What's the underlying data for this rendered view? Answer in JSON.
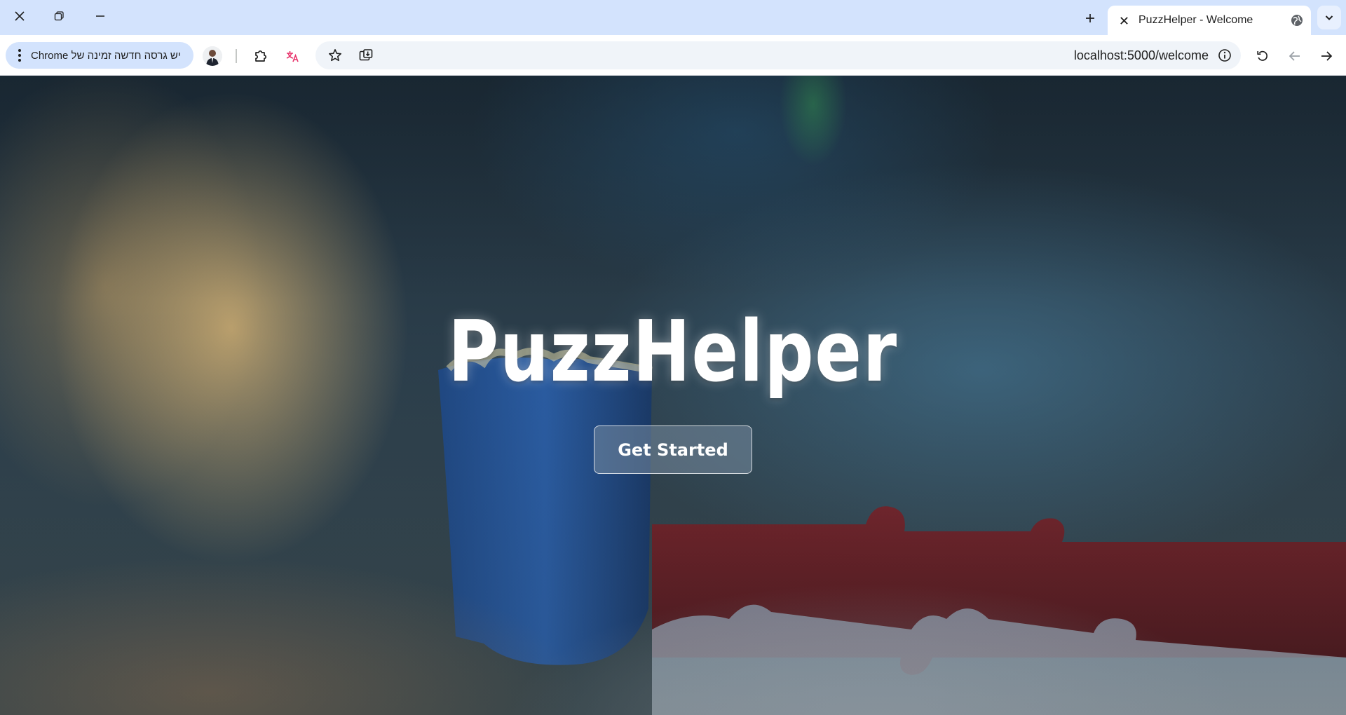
{
  "browser": {
    "tab": {
      "title": "PuzzHelper - Welcome"
    },
    "toolbar": {
      "update_chip_label": "יש גרסה חדשה זמינה של Chrome"
    },
    "omnibox": {
      "url": "localhost:5000/welcome"
    },
    "icons": {
      "close_window": "close-icon",
      "restore_window": "restore-icon",
      "minimize_window": "minimize-icon",
      "new_tab": "plus-icon",
      "tab_close": "close-icon",
      "tab_favicon": "globe-icon",
      "tab_search": "chevron-down-icon",
      "update_menu": "more-vert-icon",
      "extensions": "puzzle-piece-icon",
      "extension_translate": "translate-icon",
      "bookmark": "star-icon",
      "install_app": "install-app-icon",
      "site_info": "info-icon",
      "reload": "reload-icon",
      "back": "arrow-back-icon",
      "forward": "arrow-forward-icon"
    }
  },
  "page": {
    "hero_title": "PuzzHelper",
    "get_started_label": "Get Started"
  }
}
